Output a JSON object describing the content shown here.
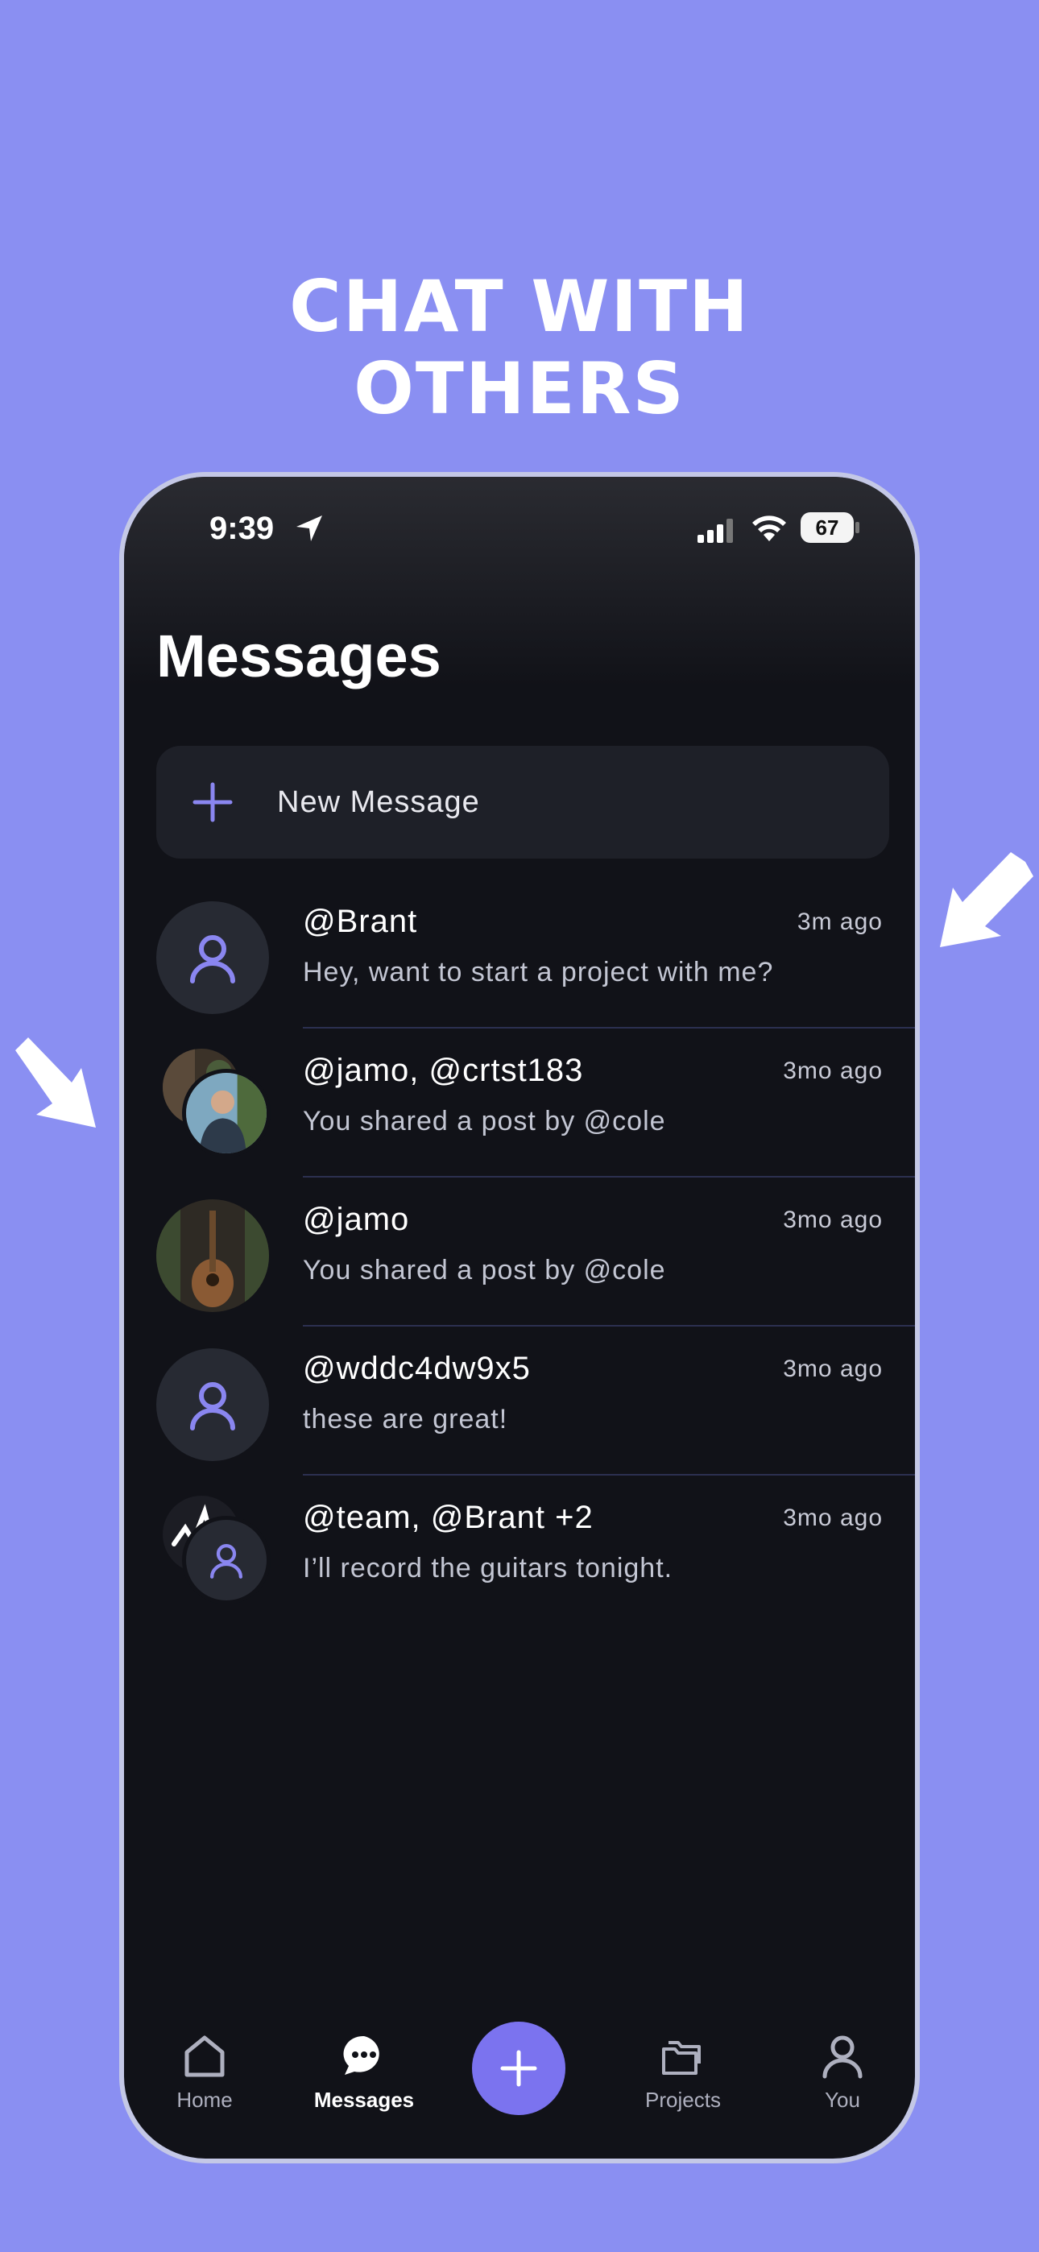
{
  "promo": {
    "headline_line1": "CHAT WITH",
    "headline_line2": "OTHERS"
  },
  "status_bar": {
    "time": "9:39",
    "battery": "67"
  },
  "page": {
    "title": "Messages"
  },
  "new_message": {
    "label": "New Message"
  },
  "conversations": [
    {
      "name": "@Brant",
      "time": "3m ago",
      "preview": "Hey, want to start a project with me?",
      "avatar": "generic"
    },
    {
      "name": "@jamo, @crtst183",
      "time": "3mo ago",
      "preview": "You shared a post by @cole",
      "avatar": "group-photos"
    },
    {
      "name": "@jamo",
      "time": "3mo ago",
      "preview": "You shared a post by @cole",
      "avatar": "photo"
    },
    {
      "name": "@wddc4dw9x5",
      "time": "3mo ago",
      "preview": "these are great!",
      "avatar": "generic"
    },
    {
      "name": "@team, @Brant +2",
      "time": "3mo ago",
      "preview": "I’ll record the guitars tonight.",
      "avatar": "group-generic"
    }
  ],
  "tabbar": {
    "home": "Home",
    "messages": "Messages",
    "projects": "Projects",
    "you": "You"
  },
  "colors": {
    "background": "#8a8ff2",
    "accent": "#7b73ef",
    "screen": "#111218",
    "card": "#1e2028"
  }
}
